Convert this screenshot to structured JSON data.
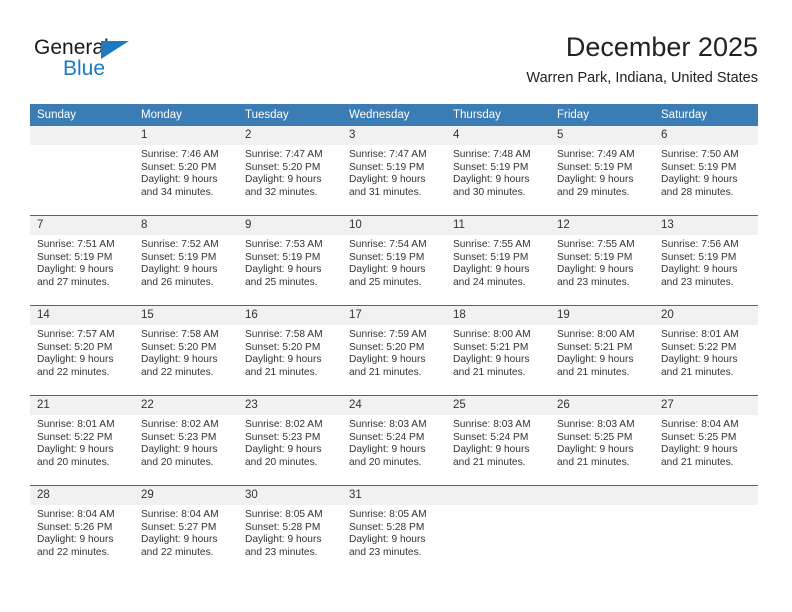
{
  "logo": {
    "word_one": "General",
    "word_two": "Blue",
    "triangle_color": "#1b7ac2",
    "text_color": "#1a1a1a"
  },
  "header": {
    "month_title": "December 2025",
    "location": "Warren Park, Indiana, United States"
  },
  "theme": {
    "header_background": "#3b7cb5",
    "header_text": "#ffffff",
    "daynum_background": "#f1f1f1",
    "row_divider": "#2f6fa8",
    "body_text": "#333333"
  },
  "weekday_headers": [
    "Sunday",
    "Monday",
    "Tuesday",
    "Wednesday",
    "Thursday",
    "Friday",
    "Saturday"
  ],
  "weeks": [
    [
      {
        "day": "",
        "sunrise": "",
        "sunset": "",
        "daylight_line1": "",
        "daylight_line2": "",
        "empty": true
      },
      {
        "day": "1",
        "sunrise": "Sunrise: 7:46 AM",
        "sunset": "Sunset: 5:20 PM",
        "daylight_line1": "Daylight: 9 hours",
        "daylight_line2": "and 34 minutes.",
        "empty": false
      },
      {
        "day": "2",
        "sunrise": "Sunrise: 7:47 AM",
        "sunset": "Sunset: 5:20 PM",
        "daylight_line1": "Daylight: 9 hours",
        "daylight_line2": "and 32 minutes.",
        "empty": false
      },
      {
        "day": "3",
        "sunrise": "Sunrise: 7:47 AM",
        "sunset": "Sunset: 5:19 PM",
        "daylight_line1": "Daylight: 9 hours",
        "daylight_line2": "and 31 minutes.",
        "empty": false
      },
      {
        "day": "4",
        "sunrise": "Sunrise: 7:48 AM",
        "sunset": "Sunset: 5:19 PM",
        "daylight_line1": "Daylight: 9 hours",
        "daylight_line2": "and 30 minutes.",
        "empty": false
      },
      {
        "day": "5",
        "sunrise": "Sunrise: 7:49 AM",
        "sunset": "Sunset: 5:19 PM",
        "daylight_line1": "Daylight: 9 hours",
        "daylight_line2": "and 29 minutes.",
        "empty": false
      },
      {
        "day": "6",
        "sunrise": "Sunrise: 7:50 AM",
        "sunset": "Sunset: 5:19 PM",
        "daylight_line1": "Daylight: 9 hours",
        "daylight_line2": "and 28 minutes.",
        "empty": false
      }
    ],
    [
      {
        "day": "7",
        "sunrise": "Sunrise: 7:51 AM",
        "sunset": "Sunset: 5:19 PM",
        "daylight_line1": "Daylight: 9 hours",
        "daylight_line2": "and 27 minutes.",
        "empty": false
      },
      {
        "day": "8",
        "sunrise": "Sunrise: 7:52 AM",
        "sunset": "Sunset: 5:19 PM",
        "daylight_line1": "Daylight: 9 hours",
        "daylight_line2": "and 26 minutes.",
        "empty": false
      },
      {
        "day": "9",
        "sunrise": "Sunrise: 7:53 AM",
        "sunset": "Sunset: 5:19 PM",
        "daylight_line1": "Daylight: 9 hours",
        "daylight_line2": "and 25 minutes.",
        "empty": false
      },
      {
        "day": "10",
        "sunrise": "Sunrise: 7:54 AM",
        "sunset": "Sunset: 5:19 PM",
        "daylight_line1": "Daylight: 9 hours",
        "daylight_line2": "and 25 minutes.",
        "empty": false
      },
      {
        "day": "11",
        "sunrise": "Sunrise: 7:55 AM",
        "sunset": "Sunset: 5:19 PM",
        "daylight_line1": "Daylight: 9 hours",
        "daylight_line2": "and 24 minutes.",
        "empty": false
      },
      {
        "day": "12",
        "sunrise": "Sunrise: 7:55 AM",
        "sunset": "Sunset: 5:19 PM",
        "daylight_line1": "Daylight: 9 hours",
        "daylight_line2": "and 23 minutes.",
        "empty": false
      },
      {
        "day": "13",
        "sunrise": "Sunrise: 7:56 AM",
        "sunset": "Sunset: 5:19 PM",
        "daylight_line1": "Daylight: 9 hours",
        "daylight_line2": "and 23 minutes.",
        "empty": false
      }
    ],
    [
      {
        "day": "14",
        "sunrise": "Sunrise: 7:57 AM",
        "sunset": "Sunset: 5:20 PM",
        "daylight_line1": "Daylight: 9 hours",
        "daylight_line2": "and 22 minutes.",
        "empty": false
      },
      {
        "day": "15",
        "sunrise": "Sunrise: 7:58 AM",
        "sunset": "Sunset: 5:20 PM",
        "daylight_line1": "Daylight: 9 hours",
        "daylight_line2": "and 22 minutes.",
        "empty": false
      },
      {
        "day": "16",
        "sunrise": "Sunrise: 7:58 AM",
        "sunset": "Sunset: 5:20 PM",
        "daylight_line1": "Daylight: 9 hours",
        "daylight_line2": "and 21 minutes.",
        "empty": false
      },
      {
        "day": "17",
        "sunrise": "Sunrise: 7:59 AM",
        "sunset": "Sunset: 5:20 PM",
        "daylight_line1": "Daylight: 9 hours",
        "daylight_line2": "and 21 minutes.",
        "empty": false
      },
      {
        "day": "18",
        "sunrise": "Sunrise: 8:00 AM",
        "sunset": "Sunset: 5:21 PM",
        "daylight_line1": "Daylight: 9 hours",
        "daylight_line2": "and 21 minutes.",
        "empty": false
      },
      {
        "day": "19",
        "sunrise": "Sunrise: 8:00 AM",
        "sunset": "Sunset: 5:21 PM",
        "daylight_line1": "Daylight: 9 hours",
        "daylight_line2": "and 21 minutes.",
        "empty": false
      },
      {
        "day": "20",
        "sunrise": "Sunrise: 8:01 AM",
        "sunset": "Sunset: 5:22 PM",
        "daylight_line1": "Daylight: 9 hours",
        "daylight_line2": "and 21 minutes.",
        "empty": false
      }
    ],
    [
      {
        "day": "21",
        "sunrise": "Sunrise: 8:01 AM",
        "sunset": "Sunset: 5:22 PM",
        "daylight_line1": "Daylight: 9 hours",
        "daylight_line2": "and 20 minutes.",
        "empty": false
      },
      {
        "day": "22",
        "sunrise": "Sunrise: 8:02 AM",
        "sunset": "Sunset: 5:23 PM",
        "daylight_line1": "Daylight: 9 hours",
        "daylight_line2": "and 20 minutes.",
        "empty": false
      },
      {
        "day": "23",
        "sunrise": "Sunrise: 8:02 AM",
        "sunset": "Sunset: 5:23 PM",
        "daylight_line1": "Daylight: 9 hours",
        "daylight_line2": "and 20 minutes.",
        "empty": false
      },
      {
        "day": "24",
        "sunrise": "Sunrise: 8:03 AM",
        "sunset": "Sunset: 5:24 PM",
        "daylight_line1": "Daylight: 9 hours",
        "daylight_line2": "and 20 minutes.",
        "empty": false
      },
      {
        "day": "25",
        "sunrise": "Sunrise: 8:03 AM",
        "sunset": "Sunset: 5:24 PM",
        "daylight_line1": "Daylight: 9 hours",
        "daylight_line2": "and 21 minutes.",
        "empty": false
      },
      {
        "day": "26",
        "sunrise": "Sunrise: 8:03 AM",
        "sunset": "Sunset: 5:25 PM",
        "daylight_line1": "Daylight: 9 hours",
        "daylight_line2": "and 21 minutes.",
        "empty": false
      },
      {
        "day": "27",
        "sunrise": "Sunrise: 8:04 AM",
        "sunset": "Sunset: 5:25 PM",
        "daylight_line1": "Daylight: 9 hours",
        "daylight_line2": "and 21 minutes.",
        "empty": false
      }
    ],
    [
      {
        "day": "28",
        "sunrise": "Sunrise: 8:04 AM",
        "sunset": "Sunset: 5:26 PM",
        "daylight_line1": "Daylight: 9 hours",
        "daylight_line2": "and 22 minutes.",
        "empty": false
      },
      {
        "day": "29",
        "sunrise": "Sunrise: 8:04 AM",
        "sunset": "Sunset: 5:27 PM",
        "daylight_line1": "Daylight: 9 hours",
        "daylight_line2": "and 22 minutes.",
        "empty": false
      },
      {
        "day": "30",
        "sunrise": "Sunrise: 8:05 AM",
        "sunset": "Sunset: 5:28 PM",
        "daylight_line1": "Daylight: 9 hours",
        "daylight_line2": "and 23 minutes.",
        "empty": false
      },
      {
        "day": "31",
        "sunrise": "Sunrise: 8:05 AM",
        "sunset": "Sunset: 5:28 PM",
        "daylight_line1": "Daylight: 9 hours",
        "daylight_line2": "and 23 minutes.",
        "empty": false
      },
      {
        "day": "",
        "sunrise": "",
        "sunset": "",
        "daylight_line1": "",
        "daylight_line2": "",
        "empty": true
      },
      {
        "day": "",
        "sunrise": "",
        "sunset": "",
        "daylight_line1": "",
        "daylight_line2": "",
        "empty": true
      },
      {
        "day": "",
        "sunrise": "",
        "sunset": "",
        "daylight_line1": "",
        "daylight_line2": "",
        "empty": true
      }
    ]
  ]
}
